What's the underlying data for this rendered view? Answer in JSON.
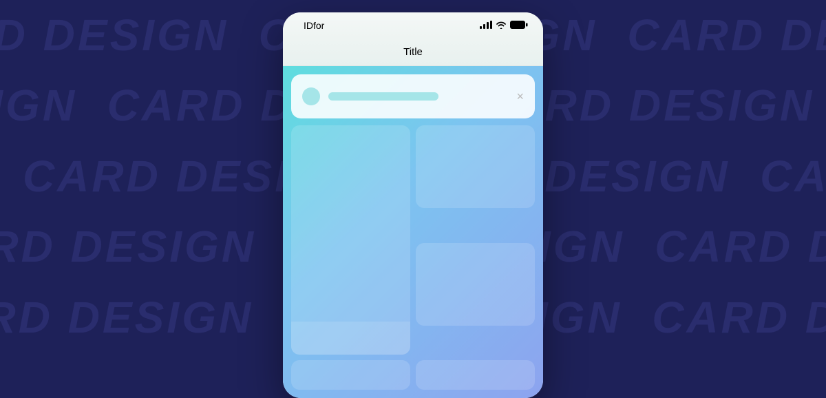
{
  "background_text": "CARD DESIGN",
  "status_bar": {
    "carrier": "IDfor"
  },
  "header": {
    "title": "Title"
  },
  "notification": {
    "close_symbol": "×"
  }
}
